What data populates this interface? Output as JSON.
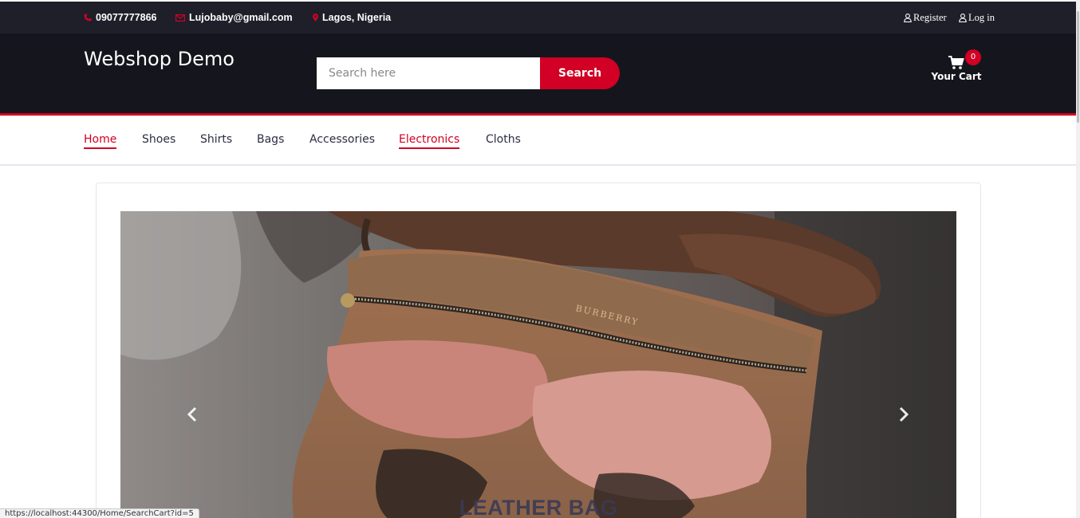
{
  "topbar": {
    "phone": "09077777866",
    "email": "Lujobaby@gmail.com",
    "location": "Lagos, Nigeria",
    "register": "Register",
    "login": "Log in"
  },
  "header": {
    "logo": "Webshop Demo",
    "search_placeholder": "Search here",
    "search_button": "Search",
    "cart_label": "Your Cart",
    "cart_count": "0"
  },
  "nav": {
    "items": [
      {
        "label": "Home",
        "active": true
      },
      {
        "label": "Shoes",
        "active": false
      },
      {
        "label": "Shirts",
        "active": false
      },
      {
        "label": "Bags",
        "active": false
      },
      {
        "label": "Accessories",
        "active": false
      },
      {
        "label": "Electronics",
        "active": true
      },
      {
        "label": "Cloths",
        "active": false
      }
    ]
  },
  "carousel": {
    "caption": "LEATHER BAG",
    "image_text": "BURBERRY"
  },
  "statusbar": {
    "url": "https://localhost:44300/Home/SearchCart?id=5"
  },
  "colors": {
    "accent": "#D10024",
    "topbar_bg": "#1e1f29",
    "header_bg": "#15161d"
  }
}
